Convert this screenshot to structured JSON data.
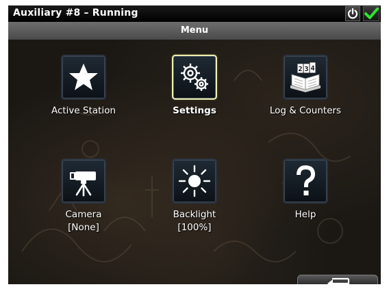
{
  "title": "Auxiliary #8 – Running",
  "header": {
    "menu_title": "Menu"
  },
  "colors": {
    "check": "#2ee52e",
    "selected_border": "#f2f0b0"
  },
  "menu": {
    "items": [
      {
        "label": "Active Station",
        "icon": "star-icon"
      },
      {
        "label": "Settings",
        "icon": "gears-icon",
        "selected": true
      },
      {
        "label": "Log & Counters",
        "icon": "logbook-icon"
      },
      {
        "label": "Camera",
        "sublabel": "[None]",
        "icon": "camera-icon"
      },
      {
        "label": "Backlight",
        "sublabel": "[100%]",
        "icon": "sun-icon"
      },
      {
        "label": "Help",
        "icon": "help-icon"
      }
    ]
  },
  "toolbar": {
    "back_icon": "back-arrow-icon",
    "power_icon": "power-icon",
    "confirm_icon": "checkmark-icon"
  }
}
